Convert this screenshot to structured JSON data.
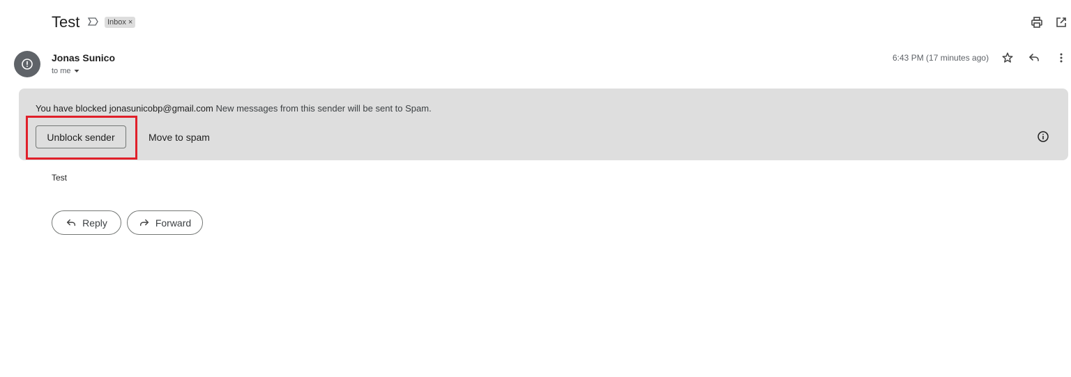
{
  "subject": "Test",
  "labels": [
    {
      "text": "Inbox",
      "remove": "×"
    }
  ],
  "toolbar": {
    "print_icon": "print-icon",
    "new_window_icon": "open-in-new-icon"
  },
  "sender": {
    "name": "Jonas Sunico",
    "recipient": "to me",
    "avatar_icon": "alert-circle-icon",
    "timestamp": "6:43 PM (17 minutes ago)"
  },
  "banner": {
    "prefix": "You have blocked ",
    "email": "jonasunicobp@gmail.com",
    "message": " New messages from this sender will be sent to Spam.",
    "unblock_label": "Unblock sender",
    "move_label": "Move to spam",
    "highlight_color": "#e0202a"
  },
  "message": {
    "body": "Test"
  },
  "actions": {
    "reply_label": "Reply",
    "forward_label": "Forward"
  }
}
